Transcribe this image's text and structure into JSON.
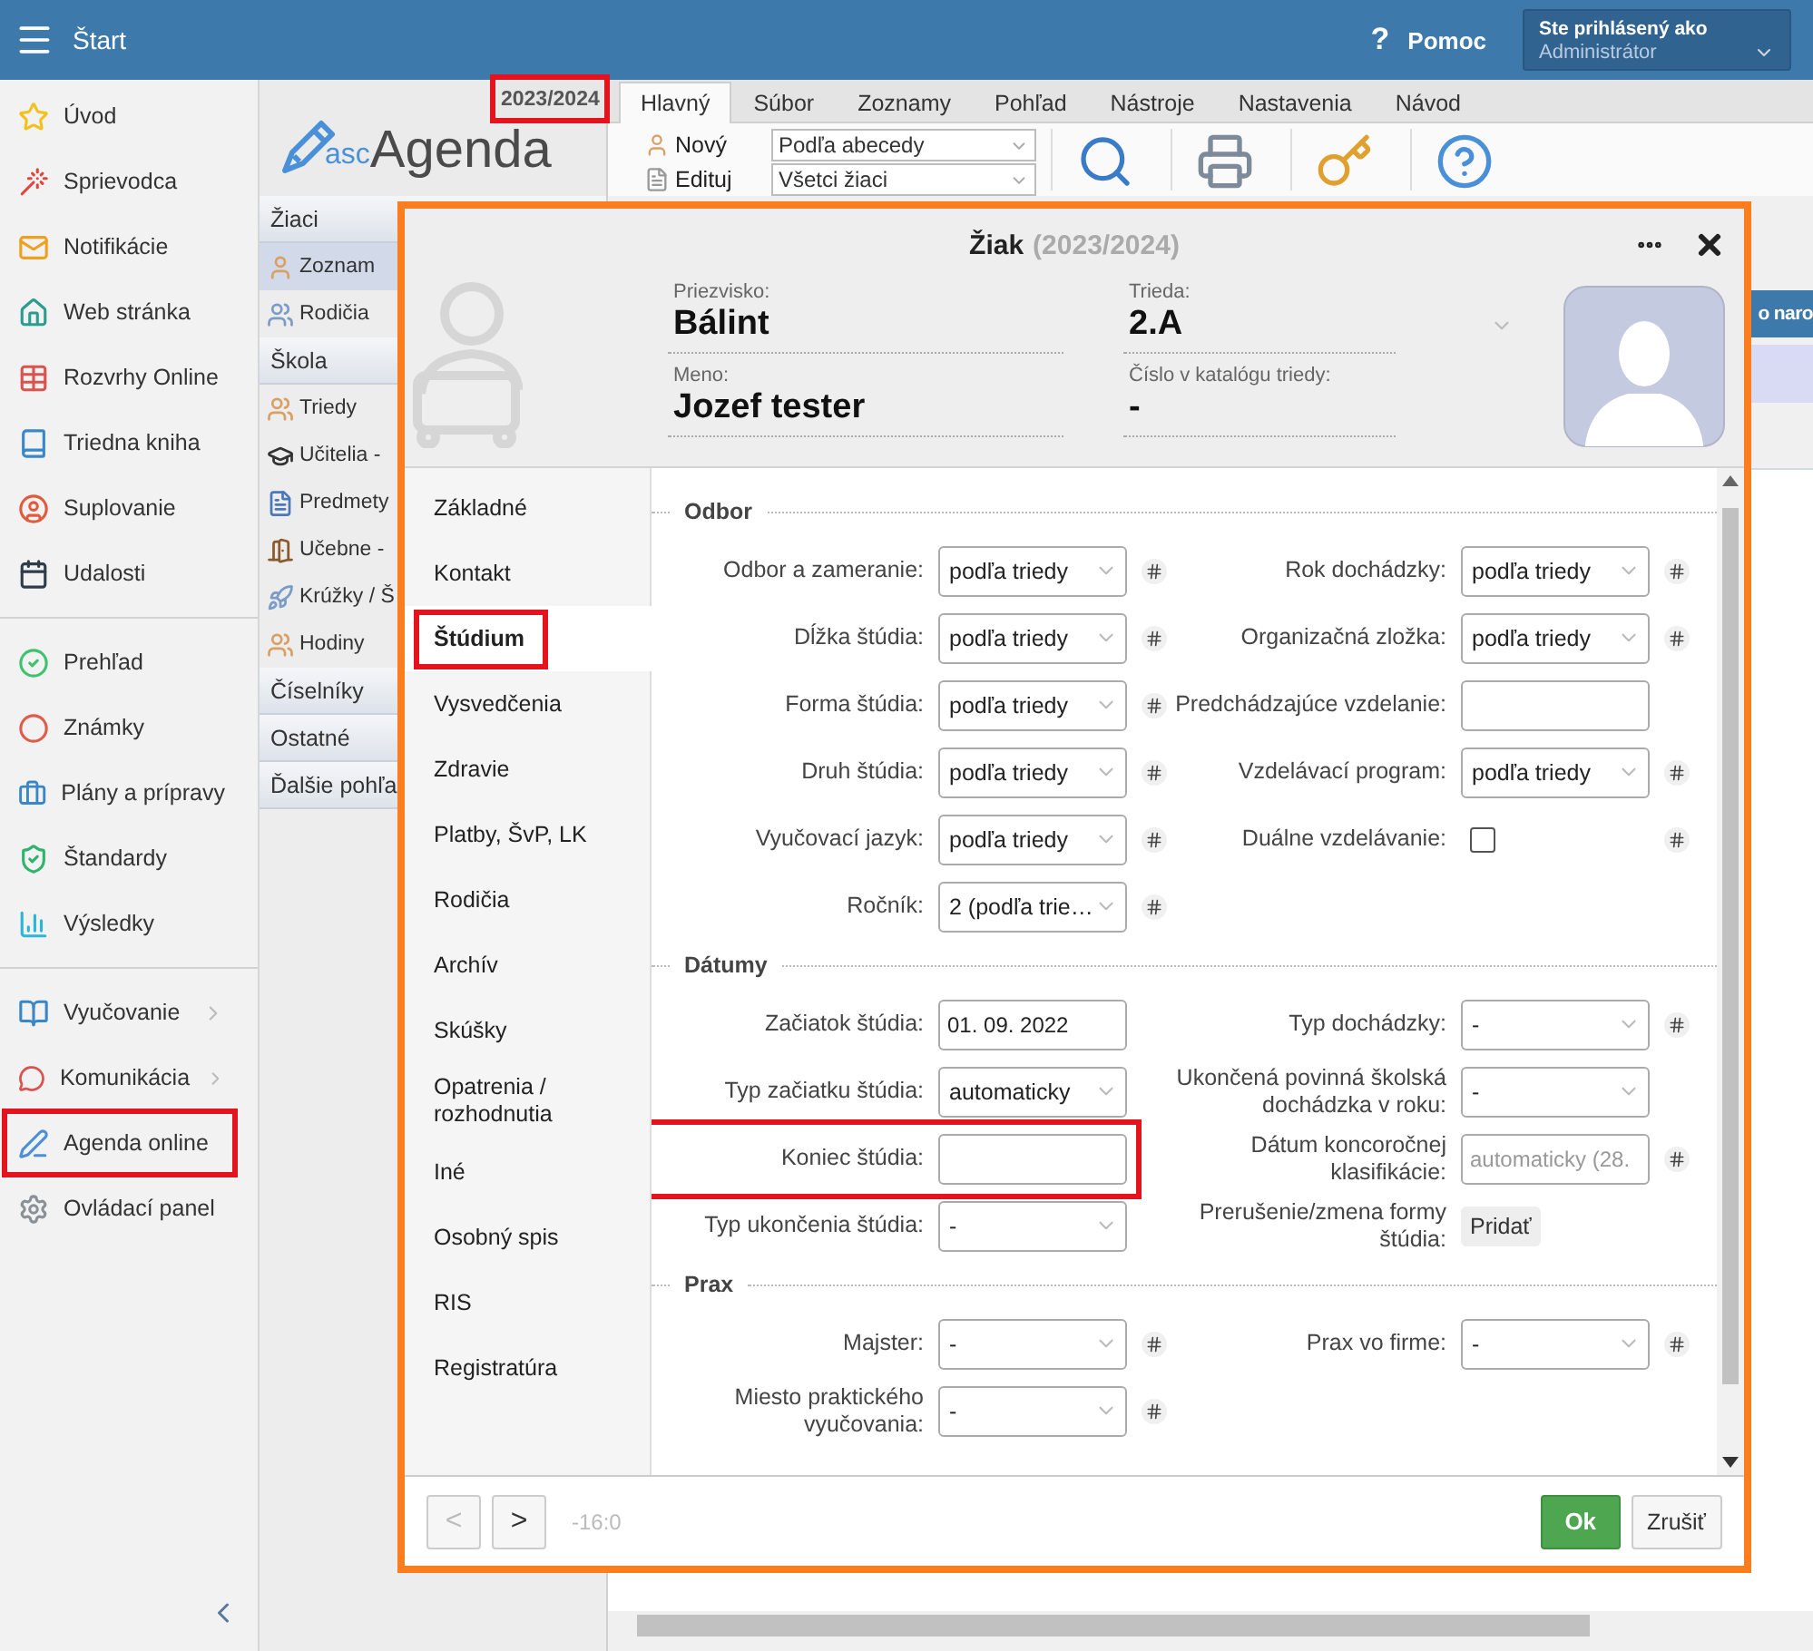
{
  "top_bar": {
    "title": "Štart",
    "help_glyph": "?",
    "help": "Pomoc",
    "user_caption": "Ste prihlásený ako",
    "user_name": "Administrátor"
  },
  "sidebar": {
    "groups": [
      {
        "items": [
          {
            "label": "Úvod",
            "has_submenu": false,
            "highlighted": false
          },
          {
            "label": "Sprievodca",
            "has_submenu": false,
            "highlighted": false
          },
          {
            "label": "Notifikácie",
            "has_submenu": false,
            "highlighted": false
          },
          {
            "label": "Web stránka",
            "has_submenu": false,
            "highlighted": false
          },
          {
            "label": "Rozvrhy Online",
            "has_submenu": false,
            "highlighted": false
          },
          {
            "label": "Triedna kniha",
            "has_submenu": false,
            "highlighted": false
          },
          {
            "label": "Suplovanie",
            "has_submenu": false,
            "highlighted": false
          },
          {
            "label": "Udalosti",
            "has_submenu": false,
            "highlighted": false
          }
        ]
      },
      {
        "items": [
          {
            "label": "Prehľad",
            "has_submenu": false,
            "highlighted": false
          },
          {
            "label": "Známky",
            "has_submenu": false,
            "highlighted": false
          },
          {
            "label": "Plány a prípravy",
            "has_submenu": false,
            "highlighted": false
          },
          {
            "label": "Štandardy",
            "has_submenu": false,
            "highlighted": false
          },
          {
            "label": "Výsledky",
            "has_submenu": false,
            "highlighted": false
          }
        ]
      },
      {
        "items": [
          {
            "label": "Vyučovanie",
            "has_submenu": true,
            "highlighted": false
          },
          {
            "label": "Komunikácia",
            "has_submenu": true,
            "highlighted": false
          },
          {
            "label": "Agenda online",
            "has_submenu": false,
            "highlighted": true
          },
          {
            "label": "Ovládací panel",
            "has_submenu": false,
            "highlighted": false
          }
        ]
      }
    ]
  },
  "app_nav": {
    "logo": {
      "prefix": "asc",
      "name": "Agenda"
    },
    "year": {
      "label": "2023/2024",
      "highlighted": true
    },
    "sections": [
      {
        "title": "Žiaci",
        "items": [
          {
            "label": "Zoznam",
            "selected": true
          },
          {
            "label": "Rodičia",
            "selected": false
          }
        ]
      },
      {
        "title": "Škola",
        "items": [
          {
            "label": "Triedy",
            "selected": false
          },
          {
            "label": "Učitelia -",
            "selected": false
          },
          {
            "label": "Predmety",
            "selected": false
          },
          {
            "label": "Učebne -",
            "selected": false
          },
          {
            "label": "Krúžky / Š",
            "selected": false
          },
          {
            "label": "Hodiny",
            "selected": false
          }
        ]
      },
      {
        "title": "Číselníky"
      },
      {
        "title": "Ostatné"
      },
      {
        "title": "Ďalšie pohľa"
      }
    ]
  },
  "ribbon": {
    "tabs": [
      {
        "label": "Hlavný",
        "selected": true
      },
      {
        "label": "Súbor",
        "selected": false
      },
      {
        "label": "Zoznamy",
        "selected": false
      },
      {
        "label": "Pohľad",
        "selected": false
      },
      {
        "label": "Nástroje",
        "selected": false
      },
      {
        "label": "Nastavenia",
        "selected": false
      },
      {
        "label": "Návod",
        "selected": false
      }
    ],
    "buttons": [
      "Nový",
      "Edituj"
    ],
    "dropdowns": [
      "Podľa abecedy",
      "Všetci žiaci"
    ]
  },
  "table": {
    "columns": [
      "o naro"
    ]
  },
  "dialog": {
    "title": "Žiak",
    "subtitle": "(2023/2024)",
    "highlighted": true,
    "header_fields": [
      {
        "label": "Priezvisko:",
        "value": "Bálint",
        "kind": "text"
      },
      {
        "label": "Trieda:",
        "value": "2.A",
        "kind": "select"
      },
      {
        "label": "Meno:",
        "value": "Jozef tester",
        "kind": "text"
      },
      {
        "label": "Číslo v katalógu triedy:",
        "value": "-",
        "kind": "text"
      }
    ],
    "tabs": [
      {
        "label": "Základné",
        "selected": false,
        "highlighted": false
      },
      {
        "label": "Kontakt",
        "selected": false,
        "highlighted": false
      },
      {
        "label": "Štúdium",
        "selected": true,
        "highlighted": true
      },
      {
        "label": "Vysvedčenia",
        "selected": false,
        "highlighted": false
      },
      {
        "label": "Zdravie",
        "selected": false,
        "highlighted": false
      },
      {
        "label": "Platby, ŠvP, LK",
        "selected": false,
        "highlighted": false
      },
      {
        "label": "Rodičia",
        "selected": false,
        "highlighted": false
      },
      {
        "label": "Archív",
        "selected": false,
        "highlighted": false
      },
      {
        "label": "Skúšky",
        "selected": false,
        "highlighted": false
      },
      {
        "label": "Opatrenia / rozhodnutia",
        "selected": false,
        "highlighted": false
      },
      {
        "label": "Iné",
        "selected": false,
        "highlighted": false
      },
      {
        "label": "Osobný spis",
        "selected": false,
        "highlighted": false
      },
      {
        "label": "RIS",
        "selected": false,
        "highlighted": false
      },
      {
        "label": "Registratúra",
        "selected": false,
        "highlighted": false
      }
    ],
    "sections": [
      {
        "title": "Odbor",
        "rows": [
          {
            "left": {
              "kind": "select",
              "label": "Odbor a zameranie:",
              "value": "podľa triedy",
              "hash": true,
              "highlighted": false
            },
            "right": {
              "kind": "select",
              "label": "Rok dochádzky:",
              "value": "podľa triedy",
              "hash": true,
              "highlighted": false
            }
          },
          {
            "left": {
              "kind": "select",
              "label": "Dĺžka štúdia:",
              "value": "podľa triedy",
              "hash": true,
              "highlighted": false
            },
            "right": {
              "kind": "select",
              "label": "Organizačná zložka:",
              "value": "podľa triedy",
              "hash": true,
              "highlighted": false
            }
          },
          {
            "left": {
              "kind": "select",
              "label": "Forma štúdia:",
              "value": "podľa triedy",
              "hash": true,
              "highlighted": false
            },
            "right": {
              "kind": "text",
              "label": "Predchádzajúce vzdelanie:",
              "hash": false,
              "highlighted": false
            }
          },
          {
            "left": {
              "kind": "select",
              "label": "Druh štúdia:",
              "value": "podľa triedy",
              "hash": true,
              "highlighted": false
            },
            "right": {
              "kind": "select",
              "label": "Vzdelávací program:",
              "value": "podľa triedy",
              "hash": true,
              "highlighted": false
            }
          },
          {
            "left": {
              "kind": "select",
              "label": "Vyučovací jazyk:",
              "value": "podľa triedy",
              "hash": true,
              "highlighted": false
            },
            "right": {
              "kind": "checkbox",
              "label": "Duálne vzdelávanie:",
              "checked": false,
              "hash": true,
              "highlighted": false
            }
          },
          {
            "left": {
              "kind": "select",
              "label": "Ročník:",
              "value": "2 (podľa trie…",
              "hash": true,
              "highlighted": false
            }
          }
        ]
      },
      {
        "title": "Dátumy",
        "rows": [
          {
            "left": {
              "kind": "text",
              "label": "Začiatok štúdia:",
              "value": "01. 09. 2022",
              "hash": false,
              "highlighted": false
            },
            "right": {
              "kind": "select",
              "label": "Typ dochádzky:",
              "value": "-",
              "hash": true,
              "highlighted": false
            }
          },
          {
            "left": {
              "kind": "select",
              "label": "Typ začiatku štúdia:",
              "value": "automaticky",
              "hash": false,
              "highlighted": false
            },
            "right": {
              "kind": "select",
              "label": "Ukončená povinná školská dochádzka v roku:",
              "value": "-",
              "hash": false,
              "highlighted": false
            }
          },
          {
            "left": {
              "kind": "text",
              "label": "Koniec štúdia:",
              "hash": false,
              "highlighted": true
            },
            "right": {
              "kind": "text",
              "label": "Dátum koncoročnej klasifikácie:",
              "placeholder": "automaticky (28.",
              "hash": true,
              "highlighted": false
            }
          },
          {
            "left": {
              "kind": "select",
              "label": "Typ ukončenia štúdia:",
              "value": "-",
              "hash": false,
              "highlighted": false
            },
            "right": {
              "kind": "button",
              "label": "Prerušenie/zmena formy štúdia:",
              "value": "Pridať",
              "hash": false,
              "highlighted": false
            }
          }
        ]
      },
      {
        "title": "Prax",
        "rows": [
          {
            "left": {
              "kind": "select",
              "label": "Majster:",
              "value": "-",
              "hash": true,
              "highlighted": false
            },
            "right": {
              "kind": "select",
              "label": "Prax vo firme:",
              "value": "-",
              "hash": true,
              "highlighted": false
            }
          },
          {
            "left": {
              "kind": "select",
              "label": "Miesto praktického vyučovania:",
              "value": "-",
              "hash": true,
              "highlighted": false
            }
          }
        ]
      }
    ],
    "footer": {
      "prev": {
        "label": "<",
        "disabled": true
      },
      "next": {
        "label": ">",
        "disabled": false
      },
      "counter": "-16:0",
      "ok": "Ok",
      "cancel": "Zrušiť"
    }
  }
}
